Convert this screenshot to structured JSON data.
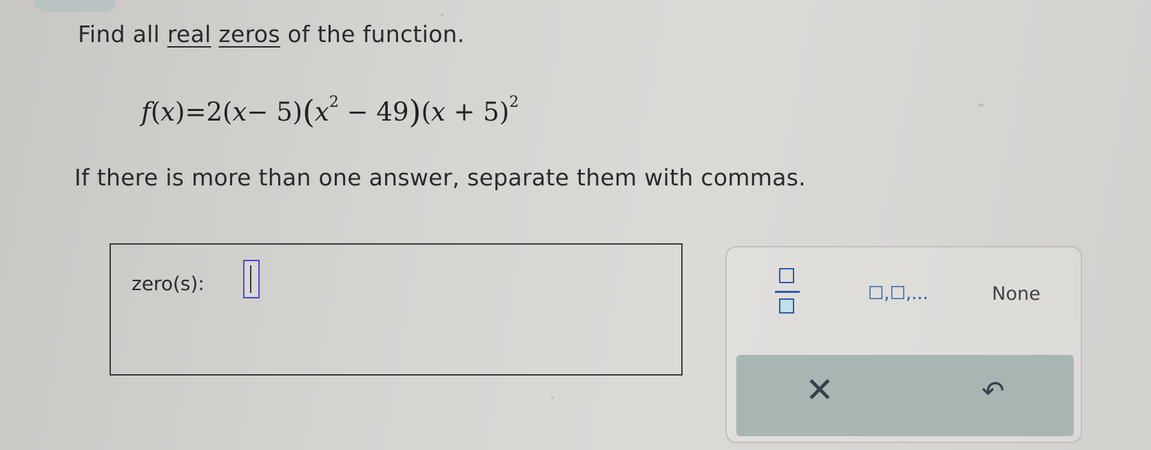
{
  "prompt": {
    "prefix": "Find all ",
    "link1": "real",
    "space": " ",
    "link2": "zeros",
    "suffix": " of the function."
  },
  "equation": {
    "fname": "f",
    "lparen": "(",
    "var": "x",
    "rparen_eq": ")=2(",
    "var2": "x",
    "minus5": "− 5)",
    "big_open": "(",
    "var3": "x",
    "sq1": "2",
    "minus49": " − 49",
    "big_close": ")",
    "open3": "(",
    "var4": "x",
    "plus5": " + 5)",
    "sq2": "2"
  },
  "instruction": "If there is more than one answer, separate them with commas.",
  "answer": {
    "label": "zero(s):",
    "value": ""
  },
  "keypad": {
    "list_label": "☐,☐,...",
    "none_label": "None",
    "clear_symbol": "✕",
    "undo_symbol": "↶"
  }
}
